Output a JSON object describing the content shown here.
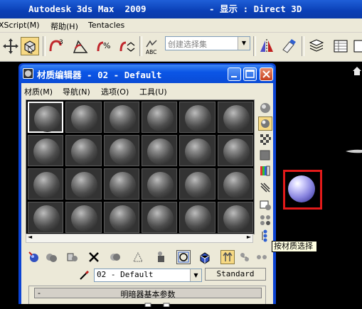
{
  "app": {
    "title_name": "Autodesk 3ds Max  2009",
    "title_mode": "- 显示 : Direct 3D"
  },
  "menubar": {
    "items": [
      "XScript(M)",
      "帮助(H)",
      "Tentacles"
    ]
  },
  "toolbar": {
    "selection_set_placeholder": "创建选择集"
  },
  "material_editor": {
    "title": "材质编辑器 - 02 - Default",
    "menu": [
      "材质(M)",
      "导航(N)",
      "选项(O)",
      "工具(U)"
    ],
    "material_name": "02 - Default",
    "material_type": "Standard",
    "rollout_minus": "-",
    "rollout_title": "明暗器基本参数",
    "slots_rows": 4,
    "slots_cols": 6,
    "active_slot": 0
  },
  "tooltip": "按材质选择",
  "colors": {
    "title_bar": "#0a3fb6",
    "selection_highlight": "#e31a1a",
    "viewport_sphere": "#8a86e0"
  },
  "icons": {
    "toolbar": [
      "select-move-icon",
      "select-object-icon",
      "link-icon",
      "snap-3d-icon",
      "angle-snap-icon",
      "percent-snap-icon",
      "spinner-snap-icon",
      "abc-edit-named-icon",
      "mirror-icon",
      "align-icon",
      "layer-manager-icon",
      "curve-editor-icon"
    ],
    "side": [
      "sample-type-icon",
      "backlight-icon",
      "background-icon",
      "tiling-icon",
      "video-check-icon",
      "make-preview-icon",
      "options-icon",
      "select-by-material-icon",
      "material-map-navigator-icon"
    ],
    "bottom": [
      "get-material-icon",
      "put-to-scene-icon",
      "assign-material-icon",
      "reset-map-icon",
      "make-unique-icon",
      "put-to-library-icon",
      "material-effects-channel-icon",
      "show-map-icon",
      "show-end-result-icon",
      "go-to-parent-icon",
      "go-forward-icon"
    ]
  }
}
